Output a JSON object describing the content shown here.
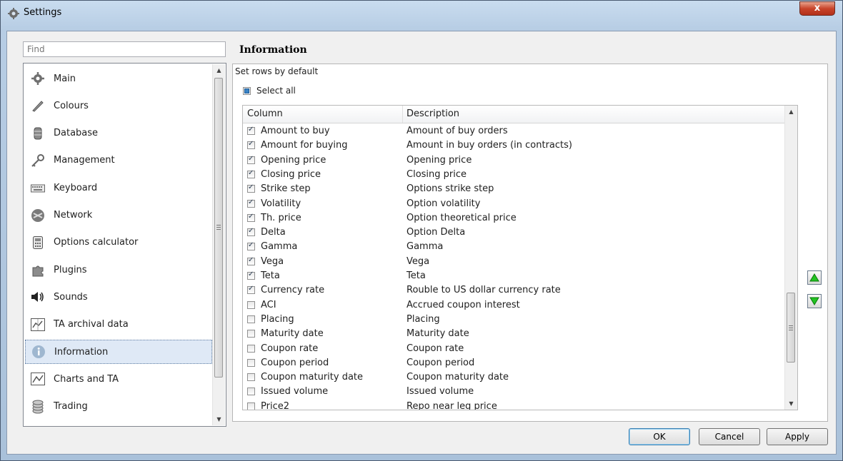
{
  "window": {
    "title": "Settings",
    "close_label": "x"
  },
  "sidebar": {
    "find_placeholder": "Find",
    "items": [
      {
        "label": "Main",
        "icon": "gear-icon"
      },
      {
        "label": "Colours",
        "icon": "brush-icon"
      },
      {
        "label": "Database",
        "icon": "database-icon"
      },
      {
        "label": "Management",
        "icon": "key-icon"
      },
      {
        "label": "Keyboard",
        "icon": "keyboard-icon"
      },
      {
        "label": "Network",
        "icon": "network-icon"
      },
      {
        "label": "Options calculator",
        "icon": "calculator-icon"
      },
      {
        "label": "Plugins",
        "icon": "puzzle-icon"
      },
      {
        "label": "Sounds",
        "icon": "speaker-icon"
      },
      {
        "label": "TA archival data",
        "icon": "archive-chart-icon"
      },
      {
        "label": "Information",
        "icon": "info-icon",
        "selected": true
      },
      {
        "label": "Charts and TA",
        "icon": "line-chart-icon"
      },
      {
        "label": "Trading",
        "icon": "coins-icon"
      }
    ]
  },
  "main": {
    "section_title": "Information",
    "group_label": "Set rows by default",
    "select_all_label": "Select all",
    "table": {
      "headers": [
        "Column",
        "Description"
      ],
      "rows": [
        {
          "column": "Amount to buy",
          "description": "Amount of buy orders",
          "checked": true
        },
        {
          "column": "Amount for buying",
          "description": "Amount in buy orders (in contracts)",
          "checked": true
        },
        {
          "column": "Opening price",
          "description": "Opening price",
          "checked": true
        },
        {
          "column": "Closing price",
          "description": "Closing price",
          "checked": true
        },
        {
          "column": "Strike step",
          "description": "Options strike step",
          "checked": true
        },
        {
          "column": "Volatility",
          "description": "Option volatility",
          "checked": true
        },
        {
          "column": "Th. price",
          "description": "Option theoretical price",
          "checked": true
        },
        {
          "column": "Delta",
          "description": "Option Delta",
          "checked": true
        },
        {
          "column": "Gamma",
          "description": "Gamma",
          "checked": true
        },
        {
          "column": "Vega",
          "description": "Vega",
          "checked": true
        },
        {
          "column": "Teta",
          "description": "Teta",
          "checked": true
        },
        {
          "column": "Currency rate",
          "description": "Rouble to US dollar currency rate",
          "checked": true
        },
        {
          "column": "ACI",
          "description": "Accrued coupon interest",
          "checked": false
        },
        {
          "column": "Placing",
          "description": "Placing",
          "checked": false
        },
        {
          "column": "Maturity date",
          "description": "Maturity date",
          "checked": false
        },
        {
          "column": "Coupon rate",
          "description": "Coupon rate",
          "checked": false
        },
        {
          "column": "Coupon period",
          "description": "Coupon period",
          "checked": false
        },
        {
          "column": "Coupon maturity date",
          "description": "Coupon maturity date",
          "checked": false
        },
        {
          "column": "Issued volume",
          "description": "Issued volume",
          "checked": false
        },
        {
          "column": "Price2",
          "description": "Repo near leg price",
          "checked": false
        }
      ]
    }
  },
  "footer": {
    "ok_label": "OK",
    "cancel_label": "Cancel",
    "apply_label": "Apply"
  }
}
